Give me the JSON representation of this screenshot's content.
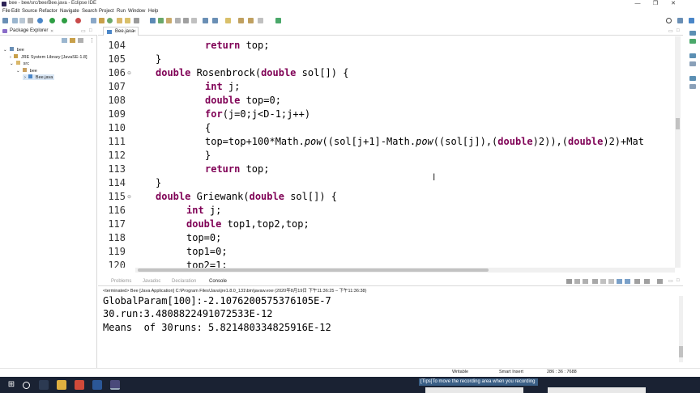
{
  "window": {
    "title": "bee - bee/src/bee/Bee.java - Eclipse IDE",
    "minimize": "—",
    "maximize": "❐",
    "close": "✕"
  },
  "menu": [
    "File",
    "Edit",
    "Source",
    "Refactor",
    "Navigate",
    "Search",
    "Project",
    "Run",
    "Window",
    "Help"
  ],
  "package_explorer": {
    "title": "Package Explorer",
    "tree": [
      {
        "label": "bee",
        "level": 0,
        "icon": "project-icon"
      },
      {
        "label": "JRE System Library [JavaSE-1.8]",
        "level": 1,
        "icon": "library-icon"
      },
      {
        "label": "src",
        "level": 1,
        "icon": "folder-icon"
      },
      {
        "label": "bee",
        "level": 2,
        "icon": "package-icon"
      },
      {
        "label": "Bee.java",
        "level": 3,
        "icon": "java-file-icon"
      }
    ]
  },
  "editor": {
    "tab_label": "Bee.java",
    "lines": [
      {
        "num": "104",
        "indent": 2,
        "tokens": [
          {
            "k": true,
            "t": "return"
          },
          {
            "t": " top;"
          }
        ]
      },
      {
        "num": "105",
        "indent": 1,
        "tokens": [
          {
            "t": "}"
          }
        ]
      },
      {
        "num": "106",
        "indent": 1,
        "fold": true,
        "tokens": [
          {
            "k": true,
            "t": "double"
          },
          {
            "t": " Rosenbrock("
          },
          {
            "k": true,
            "t": "double"
          },
          {
            "t": " sol[]) {"
          }
        ]
      },
      {
        "num": "107",
        "indent": 2,
        "tokens": [
          {
            "k": true,
            "t": "int"
          },
          {
            "t": " j;"
          }
        ]
      },
      {
        "num": "108",
        "indent": 2,
        "tokens": [
          {
            "k": true,
            "t": "double"
          },
          {
            "t": " top=0;"
          }
        ]
      },
      {
        "num": "109",
        "indent": 2,
        "tokens": [
          {
            "k": true,
            "t": "for"
          },
          {
            "t": "(j=0;j<D-1;j++)"
          }
        ]
      },
      {
        "num": "110",
        "indent": 2,
        "tokens": [
          {
            "t": "{"
          }
        ]
      },
      {
        "num": "111",
        "indent": 2,
        "tokens": [
          {
            "t": "top=top+100*Math."
          },
          {
            "i": true,
            "t": "pow"
          },
          {
            "t": "((sol[j+1]-Math."
          },
          {
            "i": true,
            "t": "pow"
          },
          {
            "t": "((sol[j]),("
          },
          {
            "k": true,
            "t": "double"
          },
          {
            "t": ")2)),("
          },
          {
            "k": true,
            "t": "double"
          },
          {
            "t": ")2)+Mat"
          }
        ]
      },
      {
        "num": "112",
        "indent": 2,
        "tokens": [
          {
            "t": "}"
          }
        ]
      },
      {
        "num": "113",
        "indent": 2,
        "tokens": [
          {
            "k": true,
            "t": "return"
          },
          {
            "t": " top;"
          }
        ]
      },
      {
        "num": "114",
        "indent": 1,
        "tokens": [
          {
            "t": "}"
          }
        ]
      },
      {
        "num": "115",
        "indent": 1,
        "fold": true,
        "tokens": [
          {
            "k": true,
            "t": "double"
          },
          {
            "t": " Griewank("
          },
          {
            "k": true,
            "t": "double"
          },
          {
            "t": " sol[]) {"
          }
        ]
      },
      {
        "num": "116",
        "indent": 3,
        "tokens": [
          {
            "k": true,
            "t": "int"
          },
          {
            "t": " j;"
          }
        ]
      },
      {
        "num": "117",
        "indent": 3,
        "tokens": [
          {
            "k": true,
            "t": "double"
          },
          {
            "t": " top1,top2,top;"
          }
        ]
      },
      {
        "num": "118",
        "indent": 3,
        "tokens": [
          {
            "t": "top=0;"
          }
        ]
      },
      {
        "num": "119",
        "indent": 3,
        "tokens": [
          {
            "t": "top1=0;"
          }
        ]
      },
      {
        "num": "120",
        "indent": 3,
        "tokens": [
          {
            "t": "top2=1;"
          }
        ]
      }
    ]
  },
  "console": {
    "tabs": [
      {
        "label": "Problems",
        "active": false
      },
      {
        "label": "Javadoc",
        "active": false
      },
      {
        "label": "Declaration",
        "active": false
      },
      {
        "label": "Console",
        "active": true
      }
    ],
    "header": "<terminated> Bee [Java Application] C:\\Program Files\\Java\\jre1.8.0_131\\bin\\javaw.exe  (2020年8月19日 下午11:36:25 – 下午11:36:38)",
    "output": [
      "GlobalParam[100]:-2.1076200575376105E-7",
      "30.run:3.4808822491072533E-12",
      "Means  of 30runs: 5.821480334825916E-12"
    ]
  },
  "status": {
    "mode": "Writable",
    "insert": "Smart Insert",
    "position": "286 : 36 : 7688"
  },
  "taskbar": {
    "tips": "[Tips]To move the recording area when you recording"
  },
  "colors": {
    "keyword": "#7f0055",
    "taskbar": "#1a2233"
  }
}
